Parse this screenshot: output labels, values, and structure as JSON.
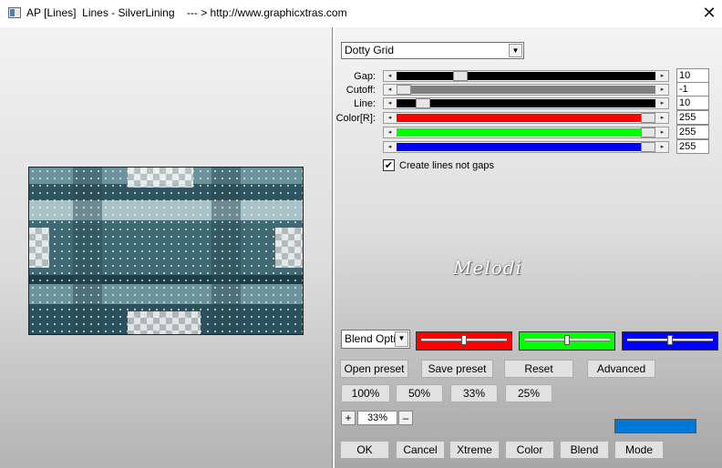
{
  "window": {
    "title": "AP [Lines]  Lines - SilverLining    --- > http://www.graphicxtras.com",
    "close_glyph": "✕"
  },
  "preset_dropdown": {
    "value": "Dotty Grid",
    "arrow_glyph": "▼"
  },
  "sliders": [
    {
      "label": "Gap:",
      "value": "10",
      "fraction": 0.23,
      "track_color": "#000000"
    },
    {
      "label": "Cutoff:",
      "value": "-1",
      "fraction": 0.0,
      "track_color": "#808080"
    },
    {
      "label": "Line:",
      "value": "10",
      "fraction": 0.08,
      "track_color": "#000000"
    },
    {
      "label": "Color[R]:",
      "value": "255",
      "fraction": 1.0,
      "track_color": "#ff0000"
    },
    {
      "label": "",
      "value": "255",
      "fraction": 1.0,
      "track_color": "#00ff00"
    },
    {
      "label": "",
      "value": "255",
      "fraction": 1.0,
      "track_color": "#0000ff"
    }
  ],
  "arrows": {
    "left": "◂",
    "right": "▸"
  },
  "create_lines_checkbox": {
    "label": "Create lines not gaps",
    "checked": true,
    "check_glyph": "✔"
  },
  "logo_text": "Melodi",
  "blend_dropdown": {
    "value": "Blend Opti",
    "arrow_glyph": "▼"
  },
  "color_panels": [
    {
      "color": "#ff0000",
      "fraction": 0.5
    },
    {
      "color": "#00ff00",
      "fraction": 0.5
    },
    {
      "color": "#0000ff",
      "fraction": 0.5
    }
  ],
  "buttons": {
    "open_preset": "Open preset",
    "save_preset": "Save preset",
    "reset": "Reset",
    "advanced": "Advanced",
    "zoom_100": "100%",
    "zoom_50": "50%",
    "zoom_33": "33%",
    "zoom_25": "25%",
    "ok": "OK",
    "cancel": "Cancel",
    "xtreme": "Xtreme",
    "color": "Color",
    "blend": "Blend",
    "mode": "Mode"
  },
  "zoom": {
    "plus": "+",
    "minus": "–",
    "value": "33%"
  },
  "swatch_color": "#0078d7"
}
